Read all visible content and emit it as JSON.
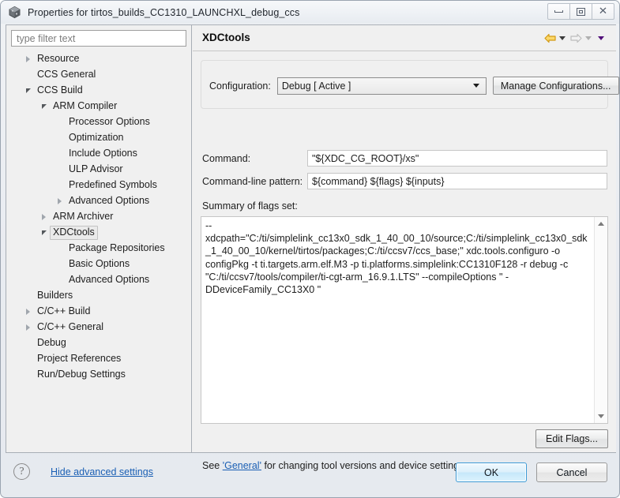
{
  "window": {
    "title": "Properties for tirtos_builds_CC1310_LAUNCHXL_debug_ccs",
    "icon": "properties-cube-icon",
    "minimize_label": "Minimize",
    "maximize_label": "Restore",
    "close_label": "Close"
  },
  "filter": {
    "placeholder": "type filter text",
    "value": ""
  },
  "tree": {
    "items": [
      {
        "label": "Resource",
        "indent": 0,
        "twisty": "collapsed",
        "selected": false
      },
      {
        "label": "CCS General",
        "indent": 0,
        "twisty": "none",
        "selected": false
      },
      {
        "label": "CCS Build",
        "indent": 0,
        "twisty": "expanded",
        "selected": false
      },
      {
        "label": "ARM Compiler",
        "indent": 1,
        "twisty": "expanded",
        "selected": false
      },
      {
        "label": "Processor Options",
        "indent": 2,
        "twisty": "none",
        "selected": false
      },
      {
        "label": "Optimization",
        "indent": 2,
        "twisty": "none",
        "selected": false
      },
      {
        "label": "Include Options",
        "indent": 2,
        "twisty": "none",
        "selected": false
      },
      {
        "label": "ULP Advisor",
        "indent": 2,
        "twisty": "none",
        "selected": false
      },
      {
        "label": "Predefined Symbols",
        "indent": 2,
        "twisty": "none",
        "selected": false
      },
      {
        "label": "Advanced Options",
        "indent": 2,
        "twisty": "collapsed",
        "selected": false
      },
      {
        "label": "ARM Archiver",
        "indent": 1,
        "twisty": "collapsed",
        "selected": false
      },
      {
        "label": "XDCtools",
        "indent": 1,
        "twisty": "expanded",
        "selected": true
      },
      {
        "label": "Package Repositories",
        "indent": 2,
        "twisty": "none",
        "selected": false
      },
      {
        "label": "Basic Options",
        "indent": 2,
        "twisty": "none",
        "selected": false
      },
      {
        "label": "Advanced Options",
        "indent": 2,
        "twisty": "none",
        "selected": false
      },
      {
        "label": "Builders",
        "indent": 0,
        "twisty": "none",
        "selected": false
      },
      {
        "label": "C/C++ Build",
        "indent": 0,
        "twisty": "collapsed",
        "selected": false
      },
      {
        "label": "C/C++ General",
        "indent": 0,
        "twisty": "collapsed",
        "selected": false
      },
      {
        "label": "Debug",
        "indent": 0,
        "twisty": "none",
        "selected": false
      },
      {
        "label": "Project References",
        "indent": 0,
        "twisty": "none",
        "selected": false
      },
      {
        "label": "Run/Debug Settings",
        "indent": 0,
        "twisty": "none",
        "selected": false
      }
    ]
  },
  "panel": {
    "title": "XDCtools",
    "nav": {
      "back_icon": "back-arrow-icon",
      "back_menu_icon": "back-history-dropdown-icon",
      "forward_icon": "forward-arrow-icon",
      "forward_menu_icon": "forward-history-dropdown-icon",
      "view_menu_icon": "view-menu-dropdown-icon"
    },
    "configuration": {
      "label": "Configuration:",
      "value": "Debug  [ Active ]",
      "manage_button": "Manage Configurations..."
    },
    "command": {
      "label": "Command:",
      "value": "\"${XDC_CG_ROOT}/xs\""
    },
    "command_line_pattern": {
      "label": "Command-line pattern:",
      "value": "${command} ${flags} ${inputs}"
    },
    "summary": {
      "label": "Summary of flags set:",
      "value": "--\nxdcpath=\"C:/ti/simplelink_cc13x0_sdk_1_40_00_10/source;C:/ti/simplelink_cc13x0_sdk_1_40_00_10/kernel/tirtos/packages;C:/ti/ccsv7/ccs_base;\" xdc.tools.configuro -o configPkg -t ti.targets.arm.elf.M3 -p ti.platforms.simplelink:CC1310F128 -r debug -c \"C:/ti/ccsv7/tools/compiler/ti-cgt-arm_16.9.1.LTS\" --compileOptions \" -DDeviceFamily_CC13X0 \""
    },
    "edit_flags_button": "Edit Flags...",
    "footnote": {
      "prefix": "See ",
      "link": "'General'",
      "suffix": " for changing tool versions and device settings"
    }
  },
  "footer": {
    "help_icon": "help-question-icon",
    "hide_advanced": "Hide advanced settings",
    "ok": "OK",
    "cancel": "Cancel"
  },
  "colors": {
    "dialog_bg": "#f0f0f0",
    "link": "#1a5fb4",
    "ok_accent": "#3c9ad6",
    "back_arrow": "#e8a317",
    "view_menu": "#51107a"
  }
}
